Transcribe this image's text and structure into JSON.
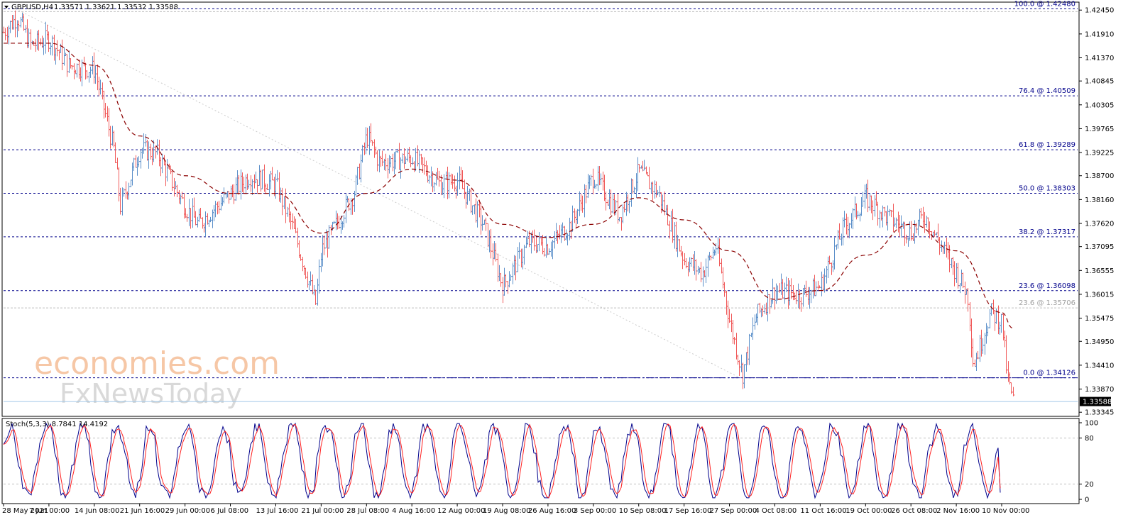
{
  "header": {
    "symbol": "GBPUSD,H4",
    "ohlc": "1.33571 1.33621 1.33532 1.33588"
  },
  "stoch": {
    "label": "Stoch(5,3,3) 8.7841 14.4192",
    "levels": [
      "100",
      "80",
      "20",
      "0"
    ]
  },
  "watermark": {
    "line1": "economies.com",
    "line2": "FxNewsToday"
  },
  "price_axis": {
    "ticks": [
      "1.42450",
      "1.41910",
      "1.41370",
      "1.40845",
      "1.40305",
      "1.39765",
      "1.39225",
      "1.38700",
      "1.38160",
      "1.37620",
      "1.37095",
      "1.36555",
      "1.36015",
      "1.35475",
      "1.34950",
      "1.34410",
      "1.33870",
      "1.33345"
    ],
    "current": "1.33588"
  },
  "time_axis": {
    "labels": [
      "28 May 2021",
      "7 Jun 00:00",
      "14 Jun 08:00",
      "21 Jun 16:00",
      "29 Jun 00:00",
      "6 Jul 08:00",
      "13 Jul 16:00",
      "21 Jul 00:00",
      "28 Jul 08:00",
      "4 Aug 16:00",
      "12 Aug 00:00",
      "19 Aug 08:00",
      "26 Aug 16:00",
      "3 Sep 00:00",
      "10 Sep 08:00",
      "17 Sep 16:00",
      "27 Sep 00:00",
      "4 Oct 08:00",
      "11 Oct 16:00",
      "19 Oct 00:00",
      "26 Oct 08:00",
      "2 Nov 16:00",
      "10 Nov 00:00"
    ]
  },
  "fib_levels": [
    {
      "label": "100.0 @ 1.42480",
      "price": 1.4248
    },
    {
      "label": "76.4 @ 1.40509",
      "price": 1.40509
    },
    {
      "label": "61.8 @ 1.39289",
      "price": 1.39289
    },
    {
      "label": "50.0 @ 1.38303",
      "price": 1.38303
    },
    {
      "label": "38.2 @ 1.37317",
      "price": 1.37317
    },
    {
      "label": "23.6 @ 1.36098",
      "price": 1.36098
    },
    {
      "label": "23.6 @ 1.35706",
      "price": 1.35706,
      "style": "gray"
    },
    {
      "label": "0.0 @ 1.34126",
      "price": 1.34126
    }
  ],
  "colors": {
    "up": "#5b8fc9",
    "down": "#f05a5a",
    "ma": "#8b0000",
    "fib": "#00008b",
    "stoch_main": "#00008b",
    "stoch_signal": "#ff2020"
  },
  "chart_data": {
    "type": "line",
    "instrument": "GBPUSD",
    "timeframe": "H4",
    "ylim": [
      1.333,
      1.4255
    ],
    "stoch_ylim": [
      0,
      100
    ],
    "close_path": [
      {
        "x": "28 May 2021",
        "y": 1.4195
      },
      {
        "x": "31 May 2021",
        "y": 1.423
      },
      {
        "x": "3 Jun 2021",
        "y": 1.4165
      },
      {
        "x": "7 Jun 00:00",
        "y": 1.418
      },
      {
        "x": "10 Jun 2021",
        "y": 1.412
      },
      {
        "x": "14 Jun 08:00",
        "y": 1.411
      },
      {
        "x": "17 Jun 2021",
        "y": 1.393
      },
      {
        "x": "18 Jun 2021",
        "y": 1.38
      },
      {
        "x": "21 Jun 16:00",
        "y": 1.393
      },
      {
        "x": "24 Jun 2021",
        "y": 1.392
      },
      {
        "x": "29 Jun 00:00",
        "y": 1.38
      },
      {
        "x": "1 Jul 2021",
        "y": 1.376
      },
      {
        "x": "6 Jul 08:00",
        "y": 1.383
      },
      {
        "x": "9 Jul 2021",
        "y": 1.387
      },
      {
        "x": "13 Jul 16:00",
        "y": 1.385
      },
      {
        "x": "16 Jul 2021",
        "y": 1.375
      },
      {
        "x": "20 Jul 2021",
        "y": 1.358
      },
      {
        "x": "21 Jul 00:00",
        "y": 1.37
      },
      {
        "x": "26 Jul 2021",
        "y": 1.383
      },
      {
        "x": "28 Jul 08:00",
        "y": 1.396
      },
      {
        "x": "30 Jul 2021",
        "y": 1.39
      },
      {
        "x": "4 Aug 16:00",
        "y": 1.391
      },
      {
        "x": "9 Aug 2021",
        "y": 1.385
      },
      {
        "x": "12 Aug 00:00",
        "y": 1.386
      },
      {
        "x": "16 Aug 2021",
        "y": 1.376
      },
      {
        "x": "19 Aug 08:00",
        "y": 1.362
      },
      {
        "x": "23 Aug 2021",
        "y": 1.372
      },
      {
        "x": "26 Aug 16:00",
        "y": 1.371
      },
      {
        "x": "30 Aug 2021",
        "y": 1.376
      },
      {
        "x": "3 Sep 00:00",
        "y": 1.387
      },
      {
        "x": "7 Sep 2021",
        "y": 1.378
      },
      {
        "x": "10 Sep 08:00",
        "y": 1.388
      },
      {
        "x": "13 Sep 2021",
        "y": 1.383
      },
      {
        "x": "17 Sep 16:00",
        "y": 1.368
      },
      {
        "x": "21 Sep 2021",
        "y": 1.365
      },
      {
        "x": "24 Sep 2021",
        "y": 1.371
      },
      {
        "x": "27 Sep 00:00",
        "y": 1.354
      },
      {
        "x": "29 Sep 2021",
        "y": 1.342
      },
      {
        "x": "1 Oct 2021",
        "y": 1.355
      },
      {
        "x": "4 Oct 08:00",
        "y": 1.361
      },
      {
        "x": "8 Oct 2021",
        "y": 1.36
      },
      {
        "x": "11 Oct 16:00",
        "y": 1.362
      },
      {
        "x": "15 Oct 2021",
        "y": 1.375
      },
      {
        "x": "19 Oct 00:00",
        "y": 1.382
      },
      {
        "x": "22 Oct 2021",
        "y": 1.378
      },
      {
        "x": "26 Oct 08:00",
        "y": 1.374
      },
      {
        "x": "28 Oct 2021",
        "y": 1.378
      },
      {
        "x": "2 Nov 16:00",
        "y": 1.365
      },
      {
        "x": "4 Nov 2021",
        "y": 1.36
      },
      {
        "x": "5 Nov 2021",
        "y": 1.344
      },
      {
        "x": "8 Nov 2021",
        "y": 1.356
      },
      {
        "x": "10 Nov 00:00",
        "y": 1.354
      },
      {
        "x": "11 Nov 2021",
        "y": 1.341
      },
      {
        "x": "12 Nov 2021",
        "y": 1.3359
      }
    ],
    "ma_path": [
      {
        "x": "28 May 2021",
        "y": 1.417
      },
      {
        "x": "7 Jun 00:00",
        "y": 1.417
      },
      {
        "x": "14 Jun 08:00",
        "y": 1.412
      },
      {
        "x": "21 Jun 16:00",
        "y": 1.396
      },
      {
        "x": "29 Jun 00:00",
        "y": 1.387
      },
      {
        "x": "6 Jul 08:00",
        "y": 1.383
      },
      {
        "x": "13 Jul 16:00",
        "y": 1.383
      },
      {
        "x": "21 Jul 00:00",
        "y": 1.374
      },
      {
        "x": "28 Jul 08:00",
        "y": 1.383
      },
      {
        "x": "4 Aug 16:00",
        "y": 1.3885
      },
      {
        "x": "12 Aug 00:00",
        "y": 1.386
      },
      {
        "x": "19 Aug 08:00",
        "y": 1.376
      },
      {
        "x": "26 Aug 16:00",
        "y": 1.373
      },
      {
        "x": "3 Sep 00:00",
        "y": 1.376
      },
      {
        "x": "10 Sep 08:00",
        "y": 1.382
      },
      {
        "x": "17 Sep 16:00",
        "y": 1.377
      },
      {
        "x": "27 Sep 00:00",
        "y": 1.37
      },
      {
        "x": "4 Oct 08:00",
        "y": 1.359
      },
      {
        "x": "11 Oct 16:00",
        "y": 1.361
      },
      {
        "x": "19 Oct 00:00",
        "y": 1.369
      },
      {
        "x": "26 Oct 08:00",
        "y": 1.376
      },
      {
        "x": "2 Nov 16:00",
        "y": 1.37
      },
      {
        "x": "10 Nov 00:00",
        "y": 1.356
      },
      {
        "x": "12 Nov 2021",
        "y": 1.3525
      }
    ],
    "series": [
      {
        "name": "Stoch(5,3,3)",
        "values": [
          8.7841,
          14.4192
        ]
      }
    ]
  }
}
